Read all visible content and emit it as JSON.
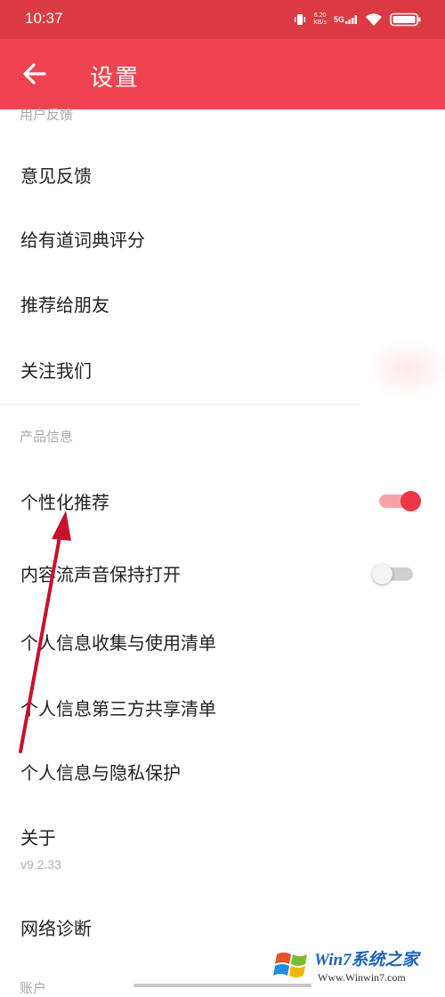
{
  "status": {
    "time": "10:37",
    "speed_value": "6.20",
    "speed_unit": "KB/s",
    "network": "5G"
  },
  "header": {
    "title": "设置"
  },
  "sections": {
    "feedback": "用户反馈",
    "product": "产品信息",
    "account": "账户"
  },
  "feedback_items": [
    "意见反馈",
    "给有道词典评分",
    "推荐给朋友",
    "关注我们"
  ],
  "product_items": {
    "personalized": {
      "label": "个性化推荐",
      "enabled": true
    },
    "content_stream": {
      "label": "内容流声音保持打开",
      "enabled": false
    },
    "info_collection": "个人信息收集与使用清单",
    "third_party": "个人信息第三方共享清单",
    "privacy": "个人信息与隐私保护",
    "about": {
      "label": "关于",
      "version": "v9.2.33"
    },
    "network_diag": "网络诊断"
  },
  "watermark": {
    "brand": "Win7系统之家",
    "url": "Www.Winwin7.com"
  },
  "colors": {
    "status_bar": "#db3a43",
    "app_bar": "#ef4450",
    "toggle_on": "#ee3746",
    "arrow": "#c8102e"
  }
}
